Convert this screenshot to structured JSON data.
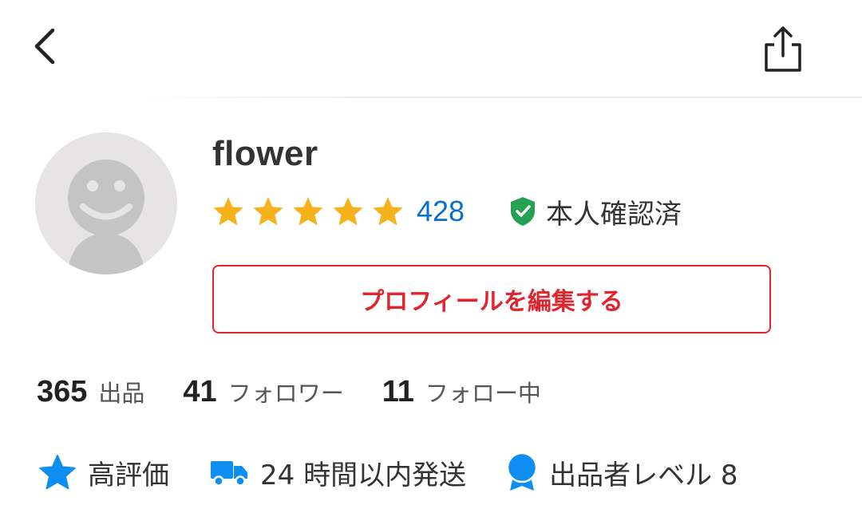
{
  "header": {
    "back_icon": "chevron-left-icon",
    "share_icon": "share-icon"
  },
  "profile": {
    "username": "flower",
    "rating": {
      "stars": 5,
      "max_stars": 5,
      "review_count": "428",
      "star_color": "#f6b21b"
    },
    "verified": {
      "icon": "shield-check-icon",
      "label": "本人確認済",
      "color": "#26a153"
    },
    "edit_button_label": "プロフィールを編集する",
    "accent_color": "#e0252f"
  },
  "stats": [
    {
      "value": "365",
      "label": "出品"
    },
    {
      "value": "41",
      "label": "フォロワー"
    },
    {
      "value": "11",
      "label": "フォロー中"
    }
  ],
  "badges": [
    {
      "icon": "star-icon",
      "label": "高評価"
    },
    {
      "icon": "truck-icon",
      "label": "24 時間以内発送"
    },
    {
      "icon": "medal-icon",
      "label": "出品者レベル 8"
    }
  ],
  "badge_icon_color": "#0d8ef0"
}
